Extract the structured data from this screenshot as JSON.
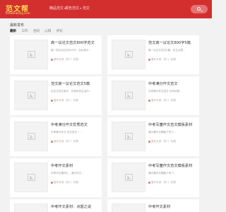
{
  "header": {
    "logo_text": "范文帮",
    "logo_sub": "fanwenbang.com",
    "nav": [
      {
        "label": "精品范文",
        "caret": "▾"
      },
      {
        "label": "报告范文",
        "caret": "▾"
      },
      {
        "label": "范文"
      }
    ]
  },
  "section_title": "最新发布",
  "tabs": [
    "最新",
    "工作",
    "合同",
    "心得",
    "评论"
  ],
  "cards": [
    {
      "title": "高一议论文范文800字范文",
      "desc": "高一范文议论文800字：议论部分…",
      "meta": [
        "爱作文网",
        "热门",
        "标签"
      ]
    },
    {
      "title": "范文高一议论文800字5篇",
      "desc": "高一议论文范文5篇，在生活里…",
      "meta": [
        "爱作文网",
        "热门",
        "标签"
      ]
    },
    {
      "title": "范文高一议论文范文5篇",
      "desc": "议论文范文高中：在现实的生活中…",
      "meta": [
        "爱作文网",
        "热门",
        "标签"
      ]
    },
    {
      "title": "中考满分作文范文",
      "desc": "中考满分作文范文 任何优秀…",
      "meta": [
        "爱作文网",
        "热门",
        "标签"
      ]
    },
    {
      "title": "中考满分作文优秀范文",
      "desc": "中考满分作文 作文范文一 …",
      "meta": [
        "爱作文网",
        "热门",
        "标签"
      ]
    },
    {
      "title": "中考写童作文范文模板素材",
      "desc": "满分要作文模板下来了…",
      "meta": [
        "爱作文网",
        "热门",
        "标签"
      ]
    },
    {
      "title": "中考作文素材",
      "desc": "中考作文素材汇，满分作文…",
      "meta": [
        "爱作文网",
        "热门",
        "标签"
      ]
    },
    {
      "title": "中考写童作文范文模板素材",
      "desc": "满分要作文模板下来了…",
      "meta": [
        "爱作文网",
        "热门",
        "标签"
      ]
    },
    {
      "title": "中考作文素材：点题之说",
      "desc": "",
      "meta": []
    },
    {
      "title": "中考作文素材",
      "desc": "",
      "meta": []
    }
  ]
}
